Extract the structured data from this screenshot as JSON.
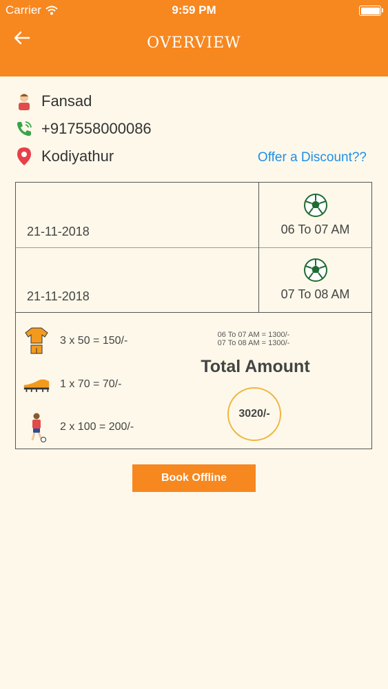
{
  "status_bar": {
    "carrier": "Carrier",
    "time": "9:59 PM"
  },
  "header": {
    "title": "OVERVIEW",
    "back_icon": "arrow-left-icon"
  },
  "customer": {
    "name": "Fansad",
    "phone": "+917558000086",
    "location": "Kodiyathur",
    "discount_link": "Offer a Discount??"
  },
  "slots": [
    {
      "date": "21-11-2018",
      "time": "06 To 07 AM",
      "icon": "football-icon"
    },
    {
      "date": "21-11-2018",
      "time": "07 To 08 AM",
      "icon": "football-icon"
    }
  ],
  "items": [
    {
      "icon": "jersey-icon",
      "text": "3 x 50 = 150/-"
    },
    {
      "icon": "shoe-icon",
      "text": "1 x 70 = 70/-"
    },
    {
      "icon": "player-icon",
      "text": "2 x 100 = 200/-"
    }
  ],
  "slot_breakdown": [
    "06 To 07 AM = 1300/-",
    "07 To 08 AM = 1300/-"
  ],
  "total": {
    "label": "Total Amount",
    "amount": "3020/-"
  },
  "book_button": "Book Offline",
  "colors": {
    "accent": "#f7871f",
    "background": "#fdf8ea",
    "link": "#1e8ee8",
    "circle": "#f0b53d"
  }
}
